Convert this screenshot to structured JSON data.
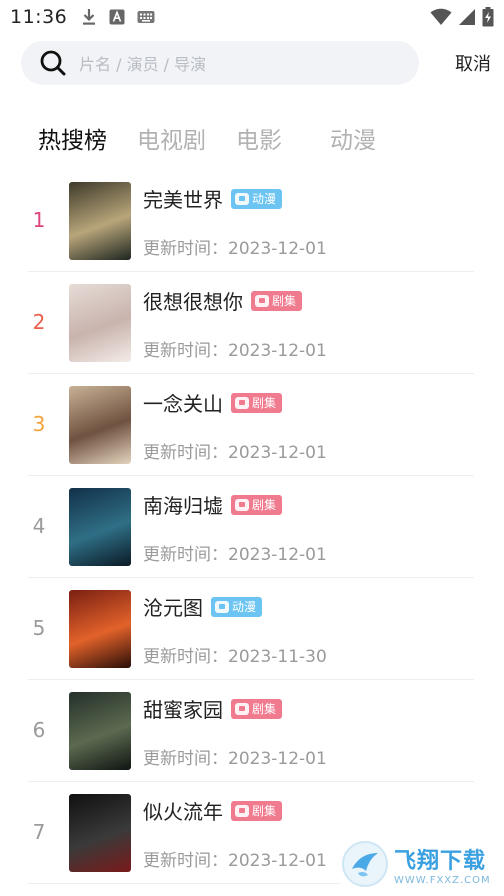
{
  "status_bar": {
    "time": "11:36",
    "icons_left": [
      "download-icon",
      "a-box-icon",
      "keyboard-icon"
    ],
    "icons_right": [
      "wifi-icon",
      "signal-icon",
      "battery-charging-icon"
    ]
  },
  "search": {
    "placeholder": "片名 / 演员 / 导演",
    "cancel_label": "取消"
  },
  "tabs": [
    {
      "label": "热搜榜",
      "active": true
    },
    {
      "label": "电视剧",
      "active": false
    },
    {
      "label": "电影",
      "active": false
    },
    {
      "label": "动漫",
      "active": false
    }
  ],
  "items": [
    {
      "rank": "1",
      "rank_color": "#e0437e",
      "title": "完美世界",
      "badge": "动漫",
      "badge_type": "anime",
      "update": "更新时间：2023-12-01",
      "poster_colors": [
        "#3d3a2a",
        "#b8a57a",
        "#1e2620"
      ]
    },
    {
      "rank": "2",
      "rank_color": "#e9614e",
      "title": "很想很想你",
      "badge": "剧集",
      "badge_type": "drama",
      "update": "更新时间：2023-12-01",
      "poster_colors": [
        "#e6dcd6",
        "#c9b3ad",
        "#f3ece8"
      ]
    },
    {
      "rank": "3",
      "rank_color": "#f0a43a",
      "title": "一念关山",
      "badge": "剧集",
      "badge_type": "drama",
      "update": "更新时间：2023-12-01",
      "poster_colors": [
        "#c8b196",
        "#6f5240",
        "#e4d4bd"
      ]
    },
    {
      "rank": "4",
      "rank_color": "#9a9a9a",
      "title": "南海归墟",
      "badge": "剧集",
      "badge_type": "drama",
      "update": "更新时间：2023-12-01",
      "poster_colors": [
        "#123049",
        "#2f6f86",
        "#0b1a26"
      ]
    },
    {
      "rank": "5",
      "rank_color": "#9a9a9a",
      "title": "沧元图",
      "badge": "动漫",
      "badge_type": "anime",
      "update": "更新时间：2023-11-30",
      "poster_colors": [
        "#7a1f12",
        "#e2622a",
        "#2a0e08"
      ]
    },
    {
      "rank": "6",
      "rank_color": "#9a9a9a",
      "title": "甜蜜家园",
      "badge": "剧集",
      "badge_type": "drama",
      "update": "更新时间：2023-12-01",
      "poster_colors": [
        "#24302a",
        "#5c6a50",
        "#0f1512"
      ]
    },
    {
      "rank": "7",
      "rank_color": "#9a9a9a",
      "title": "似火流年",
      "badge": "剧集",
      "badge_type": "drama",
      "update": "更新时间：2023-12-01",
      "poster_colors": [
        "#101010",
        "#3a3a3a",
        "#7a1a1a"
      ]
    }
  ],
  "watermark": {
    "title": "飞翔下载",
    "url": "WWW.FXXZ.COM"
  }
}
